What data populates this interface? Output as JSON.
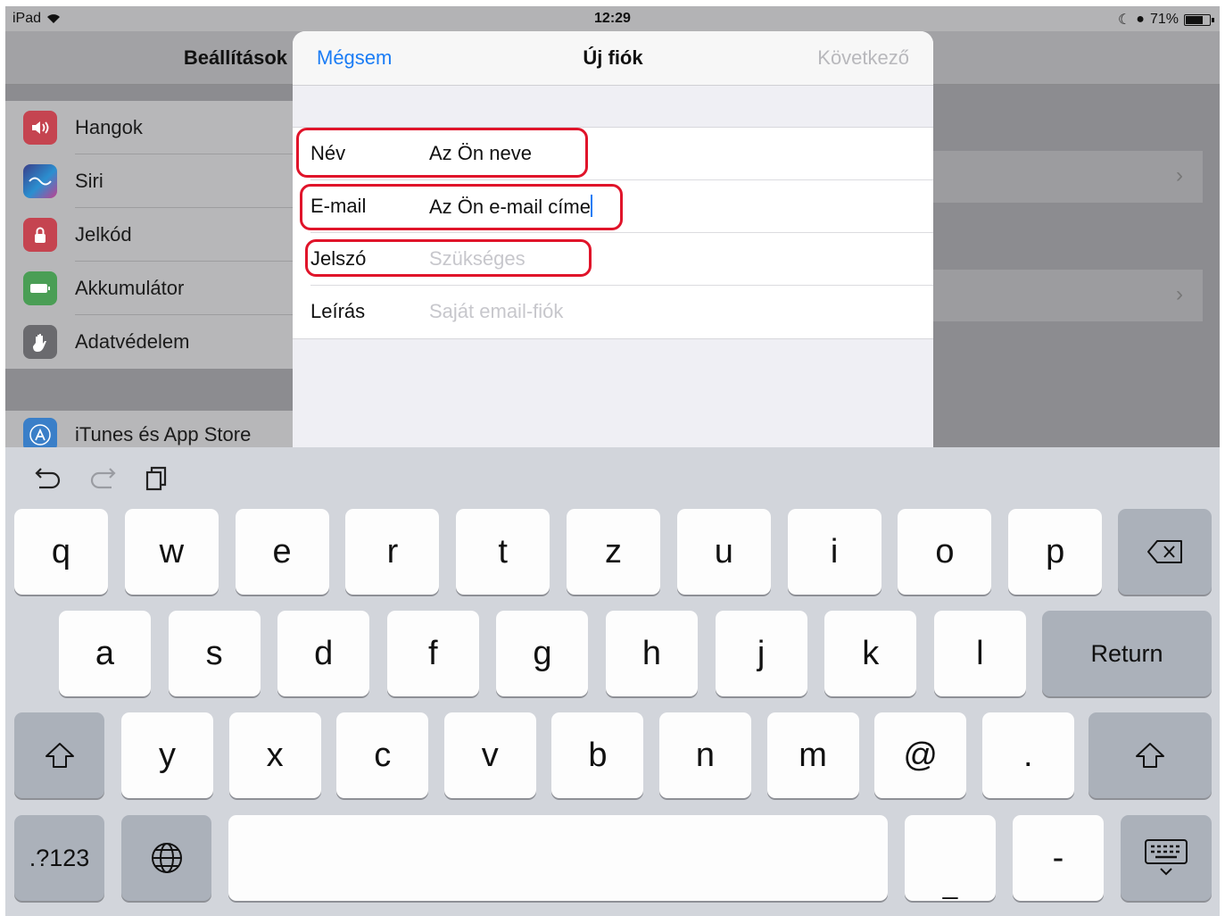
{
  "status_bar": {
    "device": "iPad",
    "time": "12:29",
    "battery": "71%",
    "battery_level": 0.71
  },
  "settings": {
    "title": "Beállítások",
    "items": [
      {
        "label": "Hangok",
        "icon": "speaker-icon",
        "color": "#e0263c"
      },
      {
        "label": "Siri",
        "icon": "siri-icon",
        "color": "#2a2d5a"
      },
      {
        "label": "Jelkód",
        "icon": "lock-icon",
        "color": "#e0263c"
      },
      {
        "label": "Akkumulátor",
        "icon": "battery-icon",
        "color": "#3bbf4a"
      },
      {
        "label": "Adatvédelem",
        "icon": "hand-icon",
        "color": "#6d6d72"
      }
    ],
    "store_item": {
      "label": "iTunes és App Store",
      "icon": "app-store-icon",
      "color": "#1f8ef5"
    }
  },
  "modal": {
    "cancel": "Mégsem",
    "title": "Új fiók",
    "next": "Következő",
    "fields": [
      {
        "label": "Név",
        "value": "Az Ön neve",
        "placeholder": false,
        "highlighted": true
      },
      {
        "label": "E-mail",
        "value": "Az Ön e-mail címe",
        "placeholder": false,
        "highlighted": true,
        "focused": true
      },
      {
        "label": "Jelszó",
        "value": "Szükséges",
        "placeholder": true,
        "highlighted": true
      },
      {
        "label": "Leírás",
        "value": "Saját email-fiók",
        "placeholder": true,
        "highlighted": false
      }
    ]
  },
  "keyboard": {
    "tools": [
      "undo-icon",
      "redo-icon",
      "paste-icon"
    ],
    "rows": [
      [
        "q",
        "w",
        "e",
        "r",
        "t",
        "z",
        "u",
        "i",
        "o",
        "p"
      ],
      [
        "a",
        "s",
        "d",
        "f",
        "g",
        "h",
        "j",
        "k",
        "l"
      ],
      [
        "y",
        "x",
        "c",
        "v",
        "b",
        "n",
        "m",
        "@",
        "."
      ]
    ],
    "return_label": "Return",
    "numbers_label": ".?123",
    "underscore": "_",
    "dash": "-",
    "space_label": ""
  },
  "colors": {
    "accent": "#1a7cf5",
    "highlight": "#e0142a"
  }
}
